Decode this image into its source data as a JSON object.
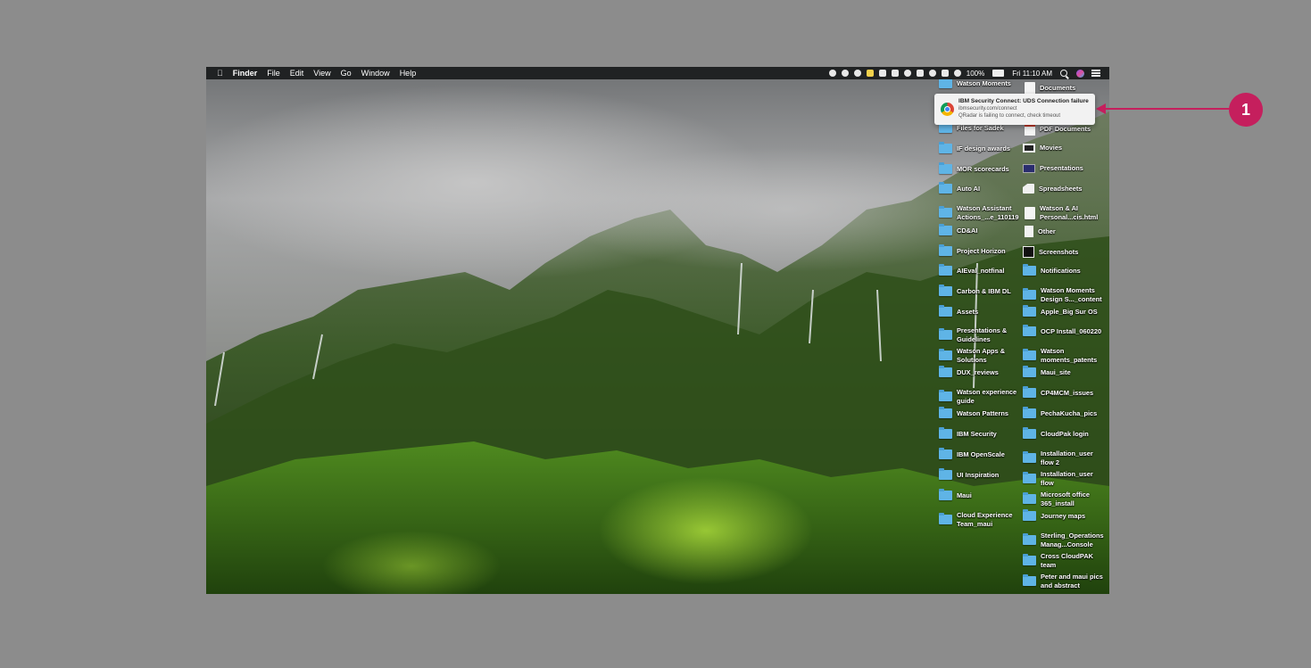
{
  "menubar": {
    "apple": "",
    "app_name": "Finder",
    "menus": [
      "File",
      "Edit",
      "View",
      "Go",
      "Window",
      "Help"
    ],
    "battery": "100%",
    "clock": "Fri 11:10 AM"
  },
  "notification": {
    "app_icon": "chrome-icon",
    "title": "IBM Security Connect: UDS Connection failure",
    "source": "ibmsecurity.com/connect",
    "message": "QRadar is failing to connect, check timeout"
  },
  "callout": {
    "number": "1",
    "color": "#c51f5d"
  },
  "desktop": {
    "left_column": [
      "Watson Moments",
      "Files for Sadek",
      "IF design awards",
      "MOR scorecards",
      "Auto AI",
      "Watson Assistant Actions_...e_110119",
      "CD&AI",
      "Project Horizon",
      "AIEval_notfinal",
      "Carbon & IBM DL",
      "Assets",
      "Presentations & Guidelines",
      "Watson Apps & Solutions",
      "DUX_reviews",
      "Watson experience guide",
      "Watson Patterns",
      "IBM Security",
      "IBM OpenScale",
      "UI Inspiration",
      "Maui",
      "Cloud Experience Team_maui"
    ],
    "right_column": [
      "Documents",
      "PDF Documents",
      "Movies",
      "Presentations",
      "Spreadsheets",
      "Watson & AI Personal...cis.html",
      "Other",
      "Screenshots",
      "Notifications",
      "Watson Moments Design S..._content",
      "Apple_Big Sur OS",
      "OCP Install_060220",
      "Watson moments_patents",
      "Maui_site",
      "CP4MCM_issues",
      "PechaKucha_pics",
      "CloudPak login",
      "Installation_user flow 2",
      "Installation_user flow",
      "Microsoft office 365_install",
      "Journey maps",
      "Sterling_Operations Manag...Console",
      "Cross CloudPAK team",
      "Peter and maui pics and abstract"
    ]
  }
}
